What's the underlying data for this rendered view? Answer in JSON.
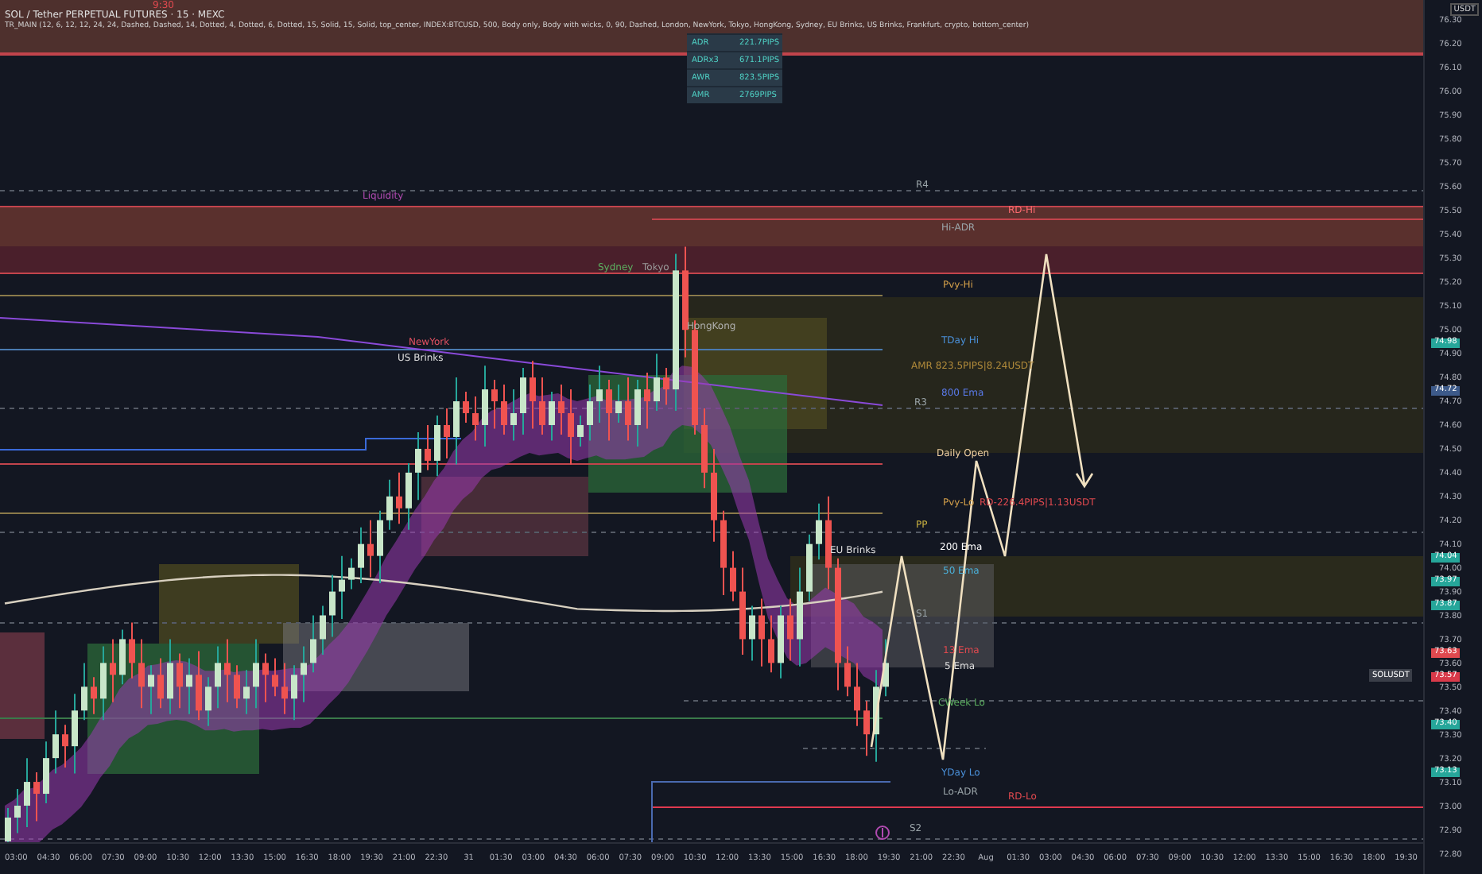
{
  "header": {
    "title": "SOL / Tether PERPETUAL FUTURES · 15 · MEXC",
    "indicator": "TR_MAIN (12, 6, 12, 12, 24, 24, Dashed, Dashed, 14, Dotted, 4, Dotted, 6, Dotted, 15, Solid, 15, Solid, top_center, INDEX:BTCUSD, 500, Body only, Body with wicks, 0, 90, Dashed, London, NewYork, Tokyo, HongKong, Sydney, EU Brinks, US Brinks, Frankfurt, crypto, bottom_center)"
  },
  "range_table": [
    {
      "name": "ADR",
      "value": "221.7PIPS"
    },
    {
      "name": "ADRx3",
      "value": "671.1PIPS"
    },
    {
      "name": "AWR",
      "value": "823.5PIPS"
    },
    {
      "name": "AMR",
      "value": "2769PIPS"
    }
  ],
  "chart_labels": [
    {
      "label": "9:30",
      "color": "#e0494f"
    },
    {
      "label": "Liquidity",
      "color": "#b04ab0"
    },
    {
      "label": "Sydney",
      "color": "#5caf60"
    },
    {
      "label": "Tokyo",
      "color": "#9a9a9a"
    },
    {
      "label": "HongKong",
      "color": "#b0b0b0"
    },
    {
      "label": "NewYork",
      "color": "#e05060"
    },
    {
      "label": "US Brinks",
      "color": "#dddddd"
    },
    {
      "label": "EU Brinks",
      "color": "#dddddd"
    },
    {
      "label": "R4",
      "color": "#9aa4a8"
    },
    {
      "label": "Hi-ADR",
      "color": "#9aa4a8"
    },
    {
      "label": "RD-Hi",
      "color": "#ff6b70"
    },
    {
      "label": "Pvy-Hi",
      "color": "#d4a04a"
    },
    {
      "label": "TDay Hi",
      "color": "#4a90d9"
    },
    {
      "label": "AMR 823.5PIPS|8.24USDT",
      "color": "#b08a3a"
    },
    {
      "label": "800 Ema",
      "color": "#5a7ae9"
    },
    {
      "label": "R3",
      "color": "#9aa4a8"
    },
    {
      "label": "Daily Open",
      "color": "#f0d0a0"
    },
    {
      "label": "Pvy-Lo",
      "color": "#d4a04a"
    },
    {
      "label": "RD-226.4PIPS|1.13USDT",
      "color": "#e0494f"
    },
    {
      "label": "PP",
      "color": "#c8b040"
    },
    {
      "label": "200 Ema",
      "color": "#ffffff"
    },
    {
      "label": "50 Ema",
      "color": "#4ab0d9"
    },
    {
      "label": "S1",
      "color": "#9aa4a8"
    },
    {
      "label": "13 Ema",
      "color": "#e0494f"
    },
    {
      "label": "5 Ema",
      "color": "#dddddd"
    },
    {
      "label": "CWeek Lo",
      "color": "#5caf60"
    },
    {
      "label": "YDay Lo",
      "color": "#4a90d9"
    },
    {
      "label": "Lo-ADR",
      "color": "#9aa4a8"
    },
    {
      "label": "RD-Lo",
      "color": "#e0494f"
    },
    {
      "label": "S2",
      "color": "#9aa4a8"
    }
  ],
  "price_axis": {
    "unit": "USDT",
    "ticks": [
      "76.30",
      "76.20",
      "76.10",
      "76.00",
      "75.90",
      "75.80",
      "75.70",
      "75.60",
      "75.50",
      "75.40",
      "75.30",
      "75.20",
      "75.10",
      "75.00",
      "74.90",
      "74.80",
      "74.70",
      "74.60",
      "74.50",
      "74.40",
      "74.30",
      "74.20",
      "74.10",
      "74.00",
      "73.90",
      "73.80",
      "73.70",
      "73.60",
      "73.50",
      "73.40",
      "73.30",
      "73.20",
      "73.10",
      "73.00",
      "72.90",
      "72.80"
    ],
    "tags": [
      {
        "value": "74.98",
        "color": "#26a69a"
      },
      {
        "value": "74.72",
        "color": "#3d5a8a"
      },
      {
        "value": "74.04",
        "color": "#26a69a"
      },
      {
        "value": "73.97",
        "color": "#26a69a"
      },
      {
        "value": "73.87",
        "color": "#26a69a"
      },
      {
        "value": "73.63",
        "color": "#e0494f"
      },
      {
        "value": "73.57",
        "color": "#d83a4a"
      },
      {
        "value": "73.40",
        "color": "#26a69a"
      },
      {
        "value": "73.13",
        "color": "#26a69a"
      }
    ],
    "symbol_tag": "SOLUSDT"
  },
  "time_axis": [
    "03:00",
    "04:30",
    "06:00",
    "07:30",
    "09:00",
    "10:30",
    "12:00",
    "13:30",
    "15:00",
    "16:30",
    "18:00",
    "19:30",
    "21:00",
    "22:30",
    "31",
    "01:30",
    "03:00",
    "04:30",
    "06:00",
    "07:30",
    "09:00",
    "10:30",
    "12:00",
    "13:30",
    "15:00",
    "16:30",
    "18:00",
    "19:30",
    "21:00",
    "22:30",
    "Aug",
    "01:30",
    "03:00",
    "04:30",
    "06:00",
    "07:30",
    "09:00",
    "10:30",
    "12:00",
    "13:30",
    "15:00",
    "16:30",
    "18:00",
    "19:30"
  ]
}
